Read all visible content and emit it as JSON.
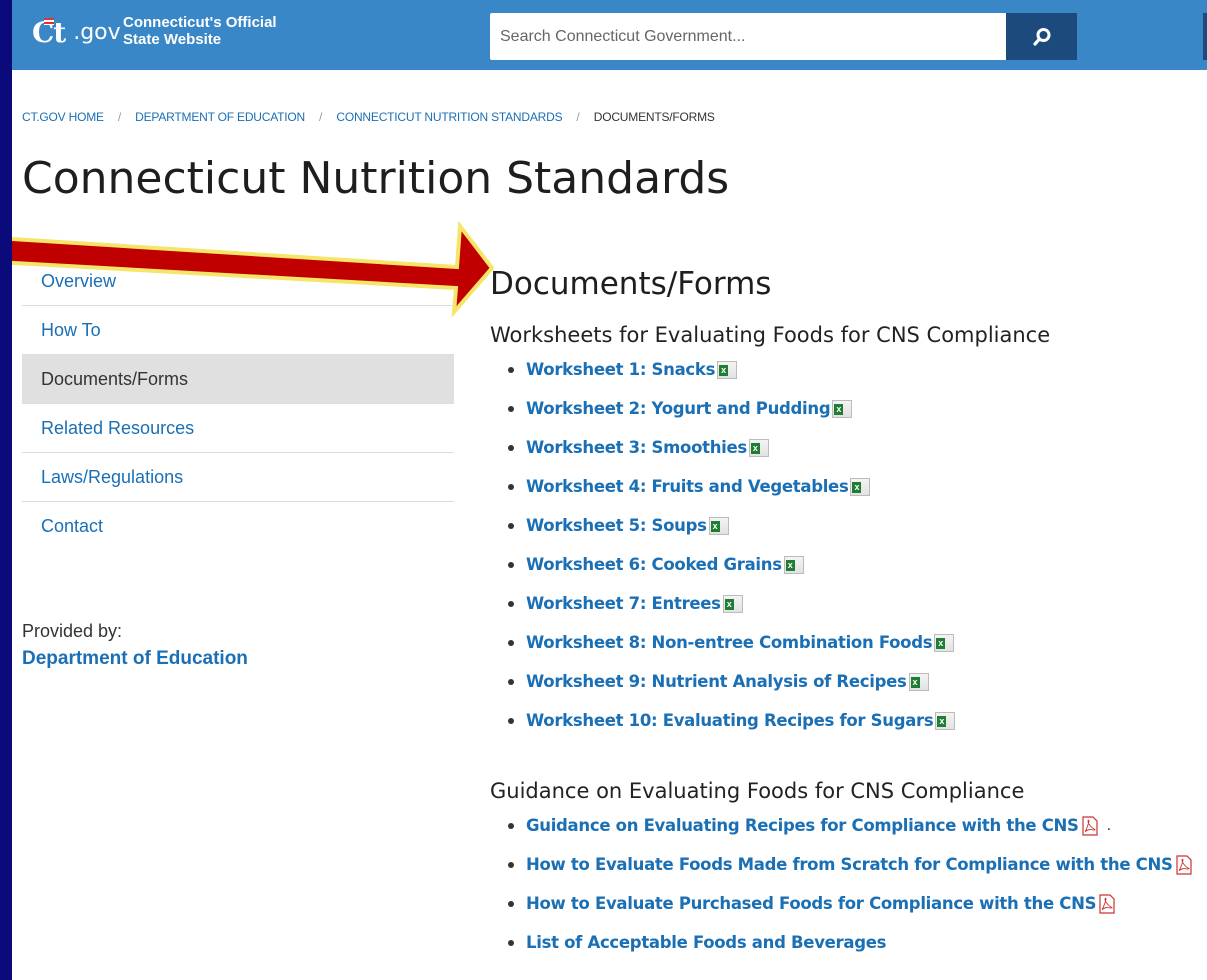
{
  "header": {
    "logo_ct": "Ct",
    "logo_gov": ".gov",
    "tagline_line1": "Connecticut's Official",
    "tagline_line2": "State Website",
    "search_placeholder": "Search Connecticut Government..."
  },
  "breadcrumb": [
    {
      "label": "CT.GOV HOME"
    },
    {
      "label": "DEPARTMENT OF EDUCATION"
    },
    {
      "label": "CONNECTICUT NUTRITION STANDARDS"
    },
    {
      "label": "DOCUMENTS/FORMS"
    }
  ],
  "page_title": "Connecticut Nutrition Standards",
  "sidebar": {
    "items": [
      {
        "label": "Overview"
      },
      {
        "label": "How To"
      },
      {
        "label": "Documents/Forms",
        "active": true
      },
      {
        "label": "Related Resources"
      },
      {
        "label": "Laws/Regulations"
      },
      {
        "label": "Contact"
      }
    ],
    "provided_label": "Provided by:",
    "provided_link": "Department of Education"
  },
  "main": {
    "section_title": "Documents/Forms",
    "worksheets_title": "Worksheets for Evaluating Foods for CNS Compliance",
    "worksheets": [
      {
        "label": "Worksheet 1: Snacks",
        "icon": "excel-icon"
      },
      {
        "label": "Worksheet 2: Yogurt and Pudding",
        "icon": "excel-icon"
      },
      {
        "label": "Worksheet 3: Smoothies",
        "icon": "excel-icon"
      },
      {
        "label": "Worksheet 4: Fruits and Vegetables",
        "icon": "excel-icon"
      },
      {
        "label": "Worksheet 5: Soups",
        "icon": "excel-icon"
      },
      {
        "label": "Worksheet 6: Cooked Grains",
        "icon": "excel-icon"
      },
      {
        "label": "Worksheet 7: Entrees",
        "icon": "excel-icon"
      },
      {
        "label": "Worksheet 8: Non-entree Combination Foods",
        "icon": "excel-icon"
      },
      {
        "label": "Worksheet 9: Nutrient Analysis of Recipes",
        "icon": "excel-icon"
      },
      {
        "label": "Worksheet 10: Evaluating Recipes for Sugars",
        "icon": "excel-icon"
      }
    ],
    "guidance_title": "Guidance on Evaluating Foods for CNS Compliance",
    "guidance": [
      {
        "label": "Guidance on Evaluating Recipes for Compliance with the CNS",
        "icon": "pdf-icon",
        "trail": "."
      },
      {
        "label": "How to Evaluate Foods Made from Scratch for Compliance with the CNS",
        "icon": "pdf-icon"
      },
      {
        "label": "How to Evaluate Purchased Foods for Compliance with the CNS",
        "icon": "pdf-icon"
      },
      {
        "label": "List of Acceptable Foods and Beverages",
        "icon": ""
      }
    ]
  },
  "colors": {
    "page_border": "#0a0a7a",
    "header_bg": "#3a87c8",
    "search_button": "#1c4a7d",
    "link": "#1a6fb5",
    "arrow_fill": "#c00000",
    "arrow_outline": "#f5e66a"
  }
}
